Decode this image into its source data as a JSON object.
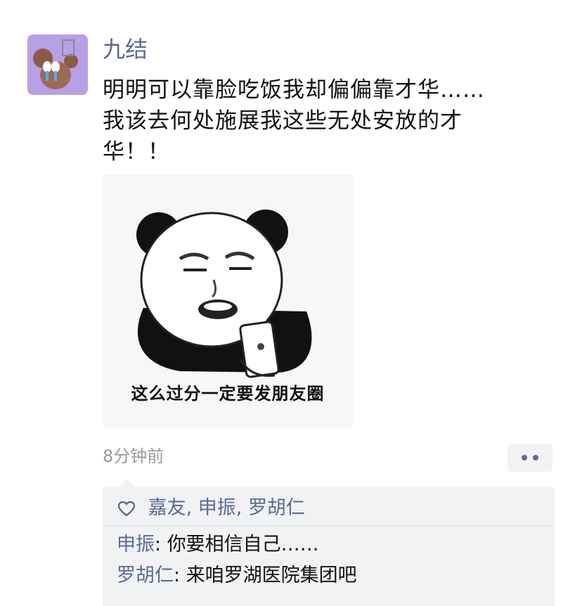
{
  "post": {
    "author": "九结",
    "text_lines": [
      "明明可以靠脸吃饭我却偏偏靠才华……",
      "我该去何处施展我这些无处安放的才",
      "华！！"
    ],
    "image_caption": "这么过分一定要发朋友圈",
    "time": "8分钟前"
  },
  "likes": {
    "icon": "heart-outline-icon",
    "names": [
      "嘉友",
      "申振",
      "罗胡仁"
    ],
    "sep1": ", ",
    "sep2": ", "
  },
  "comments": [
    {
      "author": "申振",
      "colon": ": ",
      "text": "你要相信自己……"
    },
    {
      "author": "罗胡仁",
      "colon": ": ",
      "text": "来咱罗湖医院集团吧"
    }
  ],
  "colors": {
    "name_blue": "#5a6b94",
    "comment_bg": "#f1f2f4",
    "time_gray": "#9a9a9a"
  }
}
